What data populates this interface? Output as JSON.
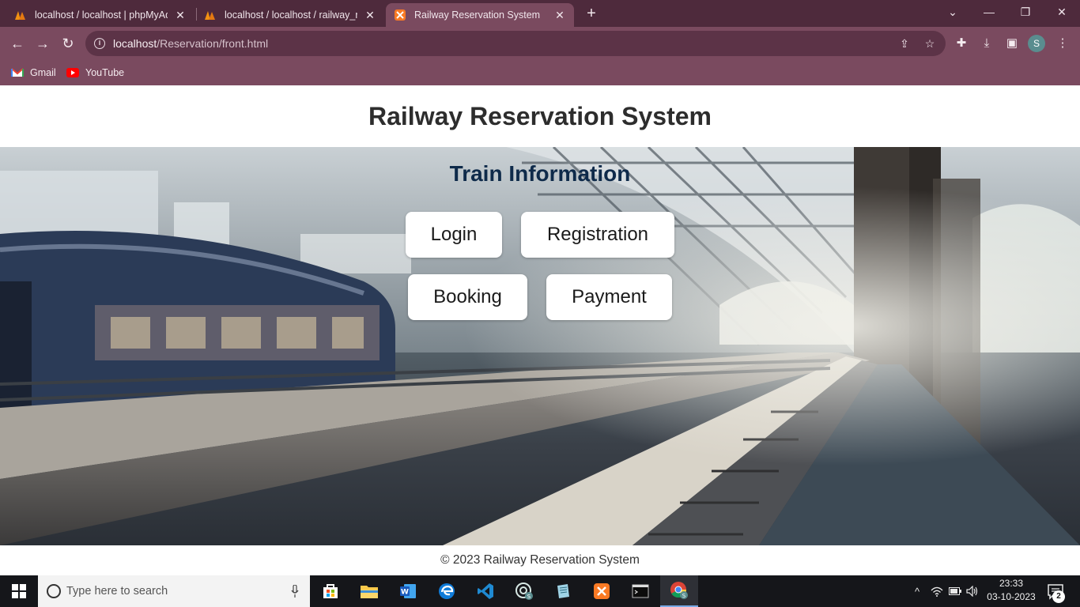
{
  "browser": {
    "tabs": [
      {
        "title": "localhost / localhost | phpMyAdmin",
        "favicon": "phpmyadmin-icon"
      },
      {
        "title": "localhost / localhost / railway_reservation",
        "favicon": "phpmyadmin-icon"
      },
      {
        "title": "Railway Reservation System",
        "favicon": "xampp-icon"
      }
    ],
    "url_host": "localhost",
    "url_path": "/Reservation/front.html",
    "bookmarks": [
      {
        "label": "Gmail",
        "icon": "gmail-icon"
      },
      {
        "label": "YouTube",
        "icon": "youtube-icon"
      }
    ],
    "profile_initial": "S"
  },
  "page": {
    "header_title": "Railway Reservation System",
    "hero_title": "Train Information",
    "buttons": {
      "login": "Login",
      "registration": "Registration",
      "booking": "Booking",
      "payment": "Payment"
    },
    "footer": "© 2023 Railway Reservation System"
  },
  "taskbar": {
    "search_placeholder": "Type here to search",
    "time": "23:33",
    "date": "03-10-2023",
    "notification_count": "2"
  },
  "colors": {
    "tab_bar": "#4e2a3c",
    "toolbar": "#7a4a5f",
    "hero_title": "#0e2a4a"
  }
}
